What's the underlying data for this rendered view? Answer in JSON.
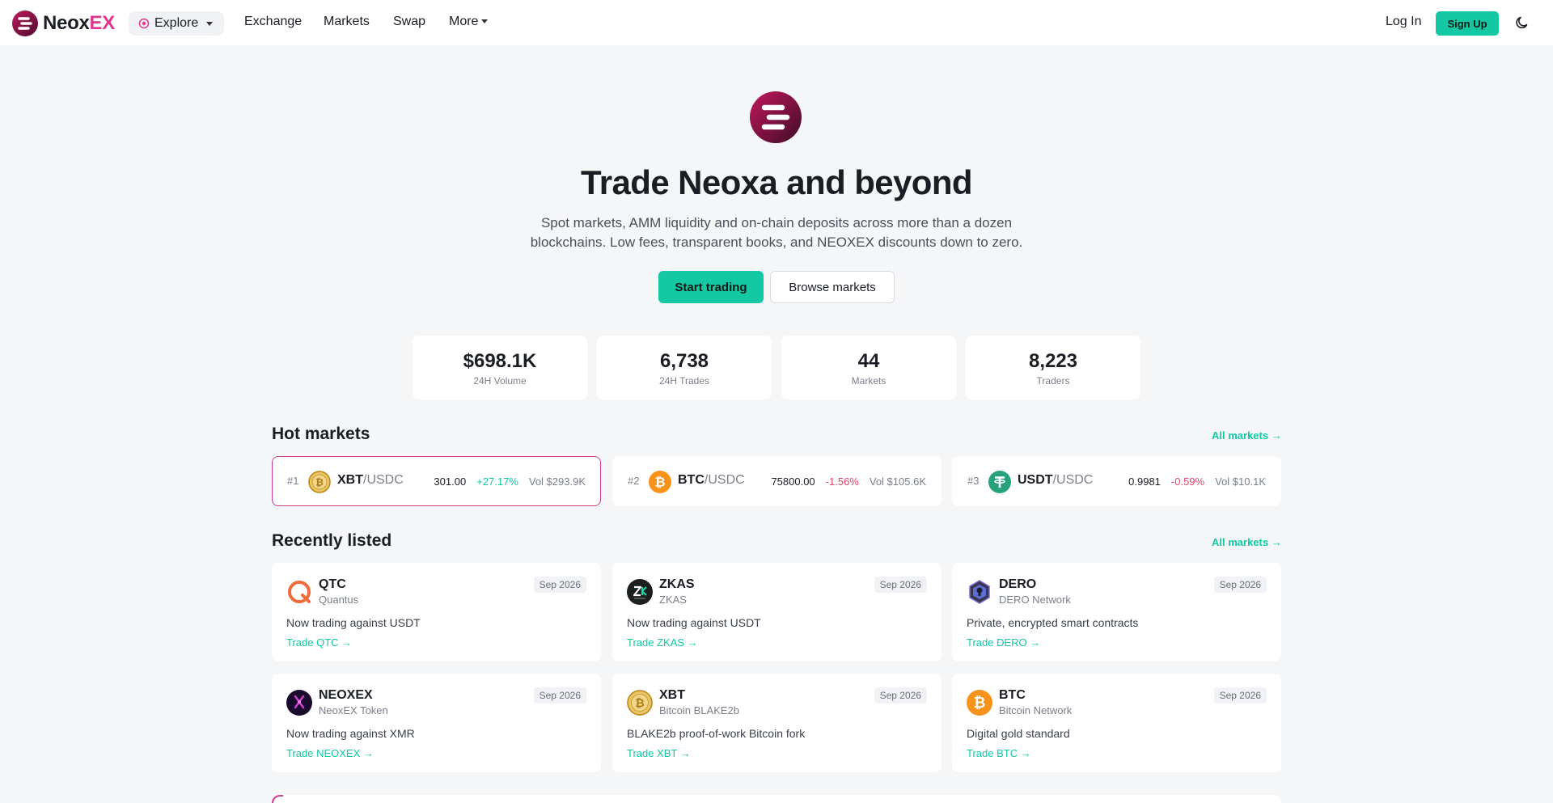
{
  "nav": {
    "brand_neox": "Neox",
    "brand_ex": "EX",
    "explore_label": "Explore",
    "links": [
      "Exchange",
      "Markets",
      "Swap",
      "More"
    ],
    "login": "Log In",
    "signup": "Sign Up"
  },
  "hero": {
    "title": "Trade Neoxa and beyond",
    "subtitle": "Spot markets, AMM liquidity and on-chain deposits across more than a dozen blockchains. Low fees, transparent books, and NEOXEX discounts down to zero.",
    "primary_button": "Start trading",
    "secondary_button": "Browse markets"
  },
  "stats": [
    {
      "value": "$698.1K",
      "label": "24H Volume"
    },
    {
      "value": "6,738",
      "label": "24H Trades"
    },
    {
      "value": "44",
      "label": "Markets"
    },
    {
      "value": "8,223",
      "label": "Traders"
    }
  ],
  "hot_markets": {
    "title": "Hot markets",
    "all_link": "All markets →",
    "items": [
      {
        "rank": "#1",
        "base": "XBT",
        "quote": "/USDC",
        "price": "301.00",
        "change": "+27.17%",
        "direction": "up",
        "volume": "Vol $293.9K",
        "icon": "xbt-coin-icon"
      },
      {
        "rank": "#2",
        "base": "BTC",
        "quote": "/USDC",
        "price": "75800.00",
        "change": "-1.56%",
        "direction": "down",
        "volume": "Vol $105.6K",
        "icon": "btc-coin-icon"
      },
      {
        "rank": "#3",
        "base": "USDT",
        "quote": "/USDC",
        "price": "0.9981",
        "change": "-0.59%",
        "direction": "down",
        "volume": "Vol $10.1K",
        "icon": "usdt-coin-icon"
      }
    ]
  },
  "recently_listed": {
    "title": "Recently listed",
    "all_link": "All markets →",
    "items": [
      {
        "symbol": "QTC",
        "name": "Quantus",
        "date": "Sep 2026",
        "desc": "Now trading against USDT",
        "trade": "Trade QTC →",
        "icon": "qtc-coin-icon"
      },
      {
        "symbol": "ZKAS",
        "name": "ZKAS",
        "date": "Sep 2026",
        "desc": "Now trading against USDT",
        "trade": "Trade ZKAS →",
        "icon": "zkas-coin-icon"
      },
      {
        "symbol": "DERO",
        "name": "DERO Network",
        "date": "Sep 2026",
        "desc": "Private, encrypted smart contracts",
        "trade": "Trade DERO →",
        "icon": "dero-coin-icon"
      },
      {
        "symbol": "NEOXEX",
        "name": "NeoxEX Token",
        "date": "Sep 2026",
        "desc": "Now trading against XMR",
        "trade": "Trade NEOXEX →",
        "icon": "neoxex-coin-icon"
      },
      {
        "symbol": "XBT",
        "name": "Bitcoin BLAKE2b",
        "date": "Sep 2026",
        "desc": "BLAKE2b proof-of-work Bitcoin fork",
        "trade": "Trade XBT →",
        "icon": "xbt-coin-icon"
      },
      {
        "symbol": "BTC",
        "name": "Bitcoin Network",
        "date": "Sep 2026",
        "desc": "Digital gold standard",
        "trade": "Trade BTC →",
        "icon": "btc-coin-icon"
      }
    ]
  },
  "colors": {
    "accent": "#14c8a4",
    "brand_pink": "#e0378f",
    "up": "#14c8a4",
    "down": "#e3456b"
  }
}
